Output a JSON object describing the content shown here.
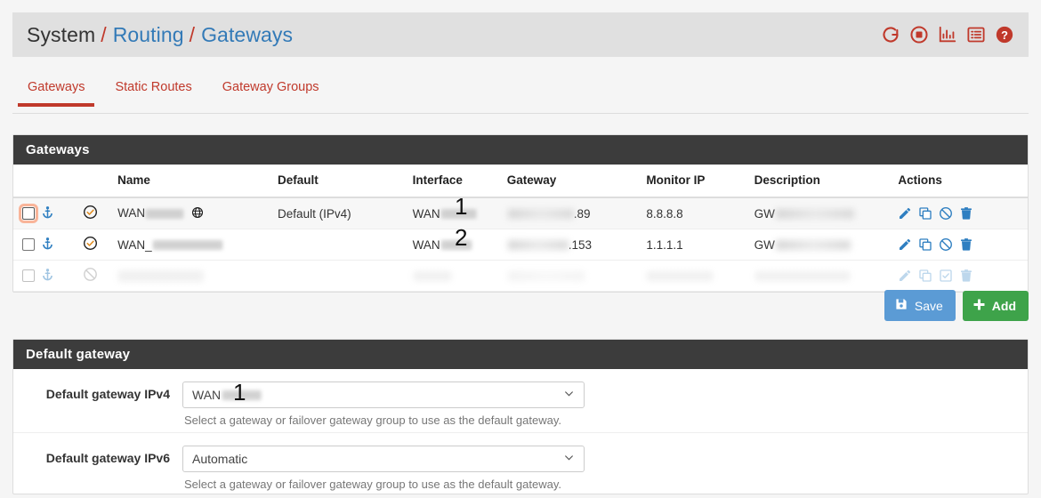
{
  "breadcrumb": {
    "root": "System",
    "sep": "/",
    "section": "Routing",
    "page": "Gateways"
  },
  "header_icons": [
    {
      "name": "reload-icon",
      "label": "Reload"
    },
    {
      "name": "stop-record-icon",
      "label": "Stop"
    },
    {
      "name": "chart-icon",
      "label": "Status Monitoring"
    },
    {
      "name": "logs-icon",
      "label": "Logs"
    },
    {
      "name": "help-icon",
      "label": "Help"
    }
  ],
  "tabs": [
    {
      "label": "Gateways",
      "active": true
    },
    {
      "label": "Static Routes",
      "active": false
    },
    {
      "label": "Gateway Groups",
      "active": false
    }
  ],
  "gateways_panel": {
    "title": "Gateways",
    "columns": [
      "",
      "",
      "Name",
      "Default",
      "Interface",
      "Gateway",
      "Monitor IP",
      "Description",
      "Actions"
    ],
    "column_labels": {
      "name": "Name",
      "default": "Default",
      "interface": "Interface",
      "gateway": "Gateway",
      "monitor_ip": "Monitor IP",
      "description": "Description",
      "actions": "Actions"
    },
    "rows": [
      {
        "selected": true,
        "focused": true,
        "status": "enabled",
        "name": "WAN",
        "name_redacted": true,
        "has_globe": true,
        "default": "Default (IPv4)",
        "interface": "WAN",
        "interface_redacted": true,
        "annotation": "1",
        "gateway": ".89",
        "gateway_redacted": true,
        "monitor_ip": "8.8.8.8",
        "description": "GW",
        "description_redacted": true,
        "actions": [
          "edit-icon",
          "copy-icon",
          "disable-icon",
          "delete-icon"
        ]
      },
      {
        "selected": false,
        "focused": false,
        "status": "enabled",
        "name": "WAN_",
        "name_redacted": true,
        "has_globe": false,
        "default": "",
        "interface": "WAN",
        "interface_redacted": true,
        "annotation": "2",
        "gateway": ".153",
        "gateway_redacted": true,
        "monitor_ip": "1.1.1.1",
        "description": "GW",
        "description_redacted": true,
        "actions": [
          "edit-icon",
          "copy-icon",
          "disable-icon",
          "delete-icon"
        ]
      },
      {
        "selected": false,
        "focused": false,
        "status": "disabled",
        "name": "",
        "name_redacted": true,
        "has_globe": false,
        "default": "",
        "interface": "",
        "interface_redacted": true,
        "annotation": "",
        "gateway": "",
        "gateway_redacted": true,
        "monitor_ip": "",
        "description": "",
        "description_redacted": true,
        "actions": [
          "edit-icon",
          "copy-icon",
          "enable-icon",
          "delete-icon"
        ]
      }
    ]
  },
  "buttons": {
    "save": "Save",
    "add": "Add"
  },
  "default_gateway_panel": {
    "title": "Default gateway",
    "ipv4": {
      "label": "Default gateway IPv4",
      "value": "WAN",
      "value_redacted": true,
      "annotation": "1",
      "help": "Select a gateway or failover gateway group to use as the default gateway."
    },
    "ipv6": {
      "label": "Default gateway IPv6",
      "value": "Automatic",
      "value_redacted": false,
      "help": "Select a gateway or failover gateway group to use as the default gateway."
    }
  },
  "colors": {
    "brand_red": "#c0392b",
    "link_blue": "#337ab7",
    "panel_dark": "#3c3c3c",
    "save_blue": "#5b9bd5",
    "add_green": "#3ea34a",
    "action_blue": "#2f7fc1",
    "status_amber": "#e08b1e",
    "focus_orange": "#f9b499"
  }
}
